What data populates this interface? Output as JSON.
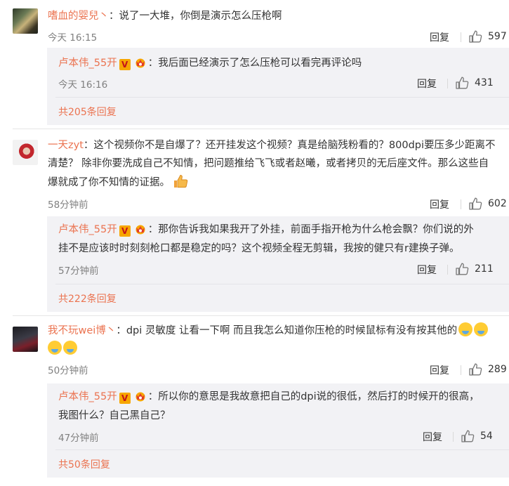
{
  "comments": [
    {
      "name": "嗜血的婴兒丶",
      "text": "说了一大堆，你倒是演示怎么压枪啊",
      "time": "今天 16:15",
      "reply_label": "回复",
      "likes": "597",
      "sub": {
        "name": "卢本伟_55开",
        "text": "我后面已经演示了怎么压枪可以看完再评论吗",
        "time": "今天 16:16",
        "reply_label": "回复",
        "likes": "431",
        "more": "共205条回复"
      }
    },
    {
      "name": "一天zyt",
      "text_l1": "这个视频你不是自爆了？还开挂发这个视频？真是给脑残粉看的？800dpi要压多少距离不",
      "text_l2": "清楚？  除非你要洗成自己不知情，把问题推给飞飞或者赵曦，或者拷贝的无后座文件。那么这些自",
      "text_l3": "爆就成了你不知情的证据。",
      "time": "58分钟前",
      "reply_label": "回复",
      "likes": "602",
      "sub": {
        "name": "卢本伟_55开",
        "text_l1": "那你告诉我如果我开了外挂，前面手指开枪为什么枪会飘？你们说的外",
        "text_l2": "挂不是应该时时刻刻枪口都是稳定的吗？这个视频全程无剪辑，我按的健只有r建换子弹。",
        "time": "57分钟前",
        "reply_label": "回复",
        "likes": "211",
        "more": "共222条回复"
      }
    },
    {
      "name": "我不玩wei博丶",
      "text": "dpi 灵敏度 让看一下啊 而且我怎么知道你压枪的时候鼠标有没有按其他的",
      "time": "50分钟前",
      "reply_label": "回复",
      "likes": "289",
      "sub": {
        "name": "卢本伟_55开",
        "text_l1": "所以你的意思是我故意把自己的dpi说的很低，然后打的时候开的很高，",
        "text_l2": "我图什么？自己黑自己？",
        "time": "47分钟前",
        "reply_label": "回复",
        "likes": "54",
        "more": "共50条回复"
      }
    }
  ],
  "badges": {
    "verified": "V"
  },
  "colors": {
    "name": "#eb7350",
    "text": "#333333",
    "meta": "#808080",
    "subbox": "#f2f2f5"
  },
  "icons": {
    "like": "thumbs-up-icon",
    "verified": "verified-v-icon",
    "member": "crown-icon"
  }
}
